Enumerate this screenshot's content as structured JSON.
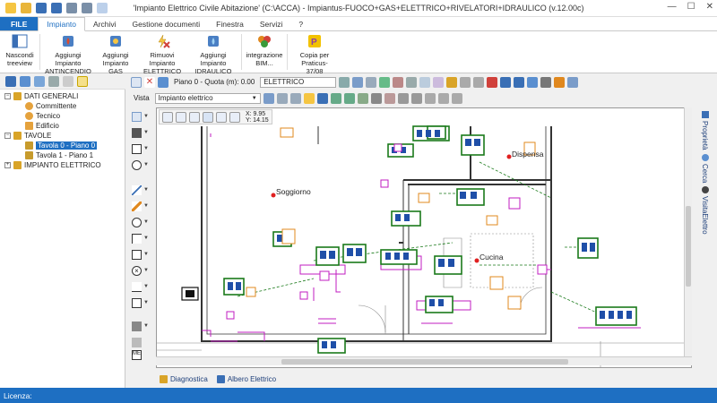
{
  "window": {
    "title": "'Impianto Elettrico Civile Abitazione' (C:\\ACCA) - Impiantus-FUOCO+GAS+ELETTRICO+RIVELATORI+IDRAULICO (v.12.00c)",
    "buttons": [
      "—",
      "☐",
      "✕"
    ]
  },
  "menu": {
    "file": "FILE",
    "tabs": [
      "Impianto",
      "Archivi",
      "Gestione documenti",
      "Finestra",
      "Servizi",
      "?"
    ]
  },
  "ribbon": {
    "buttons": [
      {
        "label": "Nascondi\ntreeview",
        "icon": "treeview-icon",
        "color": "#3a6fb5"
      },
      {
        "label": "Aggiungi Impianto\nANTINCENDIO",
        "icon": "fire-system-icon",
        "color": "#4a7fc4"
      },
      {
        "label": "Aggiungi\nImpianto GAS",
        "icon": "gas-system-icon",
        "color": "#4a7fc4"
      },
      {
        "label": "Rimuovi Impianto\nELETTRICO",
        "icon": "remove-electric-icon",
        "color": "#d0413b"
      },
      {
        "label": "Aggiungi Impianto\nIDRAULICO",
        "icon": "hydraulic-icon",
        "color": "#4a7fc4"
      },
      {
        "label": "integrazione\nBIM...",
        "icon": "bim-icon",
        "color": "#e0881e"
      },
      {
        "label": "Copia per\nPraticus-37/08",
        "icon": "praticus-icon",
        "color": "#8a3da8"
      }
    ]
  },
  "tree": {
    "items": [
      {
        "label": "DATI GENERALI",
        "level": 0,
        "expander": "-",
        "color": "#d9a428"
      },
      {
        "label": "Committente",
        "level": 1,
        "color": "#e5a23d"
      },
      {
        "label": "Tecnico",
        "level": 1,
        "color": "#e5a23d"
      },
      {
        "label": "Edificio",
        "level": 1,
        "color": "#e5a23d"
      },
      {
        "label": "TAVOLE",
        "level": 0,
        "expander": "-",
        "color": "#d9a428"
      },
      {
        "label": "Tavola 0 - Piano 0",
        "level": 1,
        "selected": true,
        "color": "#c79b2c"
      },
      {
        "label": "Tavola 1 - Piano 1",
        "level": 1,
        "color": "#c79b2c"
      },
      {
        "label": "IMPIANTO ELETTRICO",
        "level": 0,
        "expander": "+",
        "color": "#d9a428"
      }
    ]
  },
  "toolbar": {
    "piano_label": "Piano 0 - Quota (m): 0.00",
    "layer_value": "ELETTRICO",
    "vista_label": "Vista",
    "vista_value": "Impianto elettrico"
  },
  "canvas": {
    "coords": {
      "x": "X: 9.95",
      "y": "Y: 14.15"
    },
    "rooms": [
      {
        "name": "Soggiorno"
      },
      {
        "name": "Dispensa"
      },
      {
        "name": "Cucina"
      }
    ],
    "wall_color": "#333333",
    "circuit_color": "#c11cc1",
    "wiring_color": "#1a7a1a",
    "device_color": "#e0881e"
  },
  "right_tabs": [
    "Proprietà",
    "Cerca",
    "VisitaElettro"
  ],
  "bottom_tabs": [
    "Diagnostica",
    "Albero Elettrico"
  ],
  "status": {
    "label": "Licenza:"
  },
  "accent": "#1e6fc2"
}
